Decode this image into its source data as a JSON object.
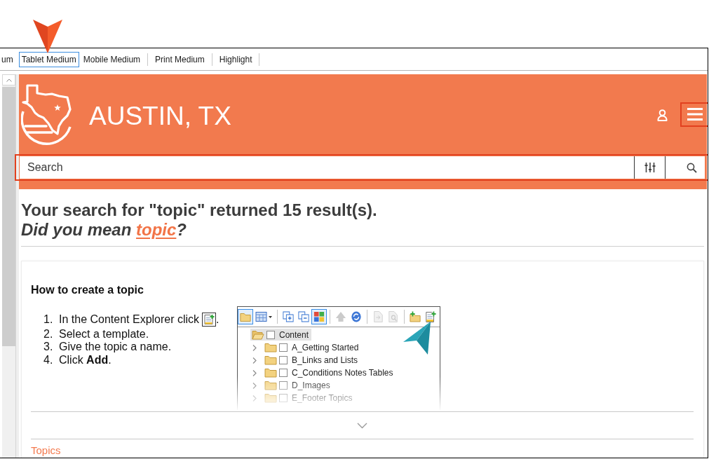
{
  "toolbar": {
    "tabs": [
      {
        "label": "um",
        "selected": false
      },
      {
        "label": "Tablet Medium",
        "selected": true
      },
      {
        "label": "Mobile Medium",
        "selected": false
      },
      {
        "label": "Print Medium",
        "selected": false
      },
      {
        "label": "Highlight",
        "selected": false
      }
    ]
  },
  "header": {
    "title": "AUSTIN, TX"
  },
  "search": {
    "placeholder": "Search"
  },
  "results": {
    "summary": "Your search for \"topic\" returned 15 result(s).",
    "suggestion": {
      "before": "Did you mean",
      "link": "topic",
      "after": "?"
    }
  },
  "result": {
    "title": "How to create a topic",
    "steps": [
      {
        "number": "1.",
        "kind": "icon",
        "text": "In the Content Explorer click",
        "after": "."
      },
      {
        "number": "2.",
        "kind": "text",
        "text": "Select a template."
      },
      {
        "number": "3.",
        "kind": "text",
        "text": "Give the topic a name."
      },
      {
        "number": "4.",
        "kind": "text",
        "text": "Click **Add**."
      }
    ],
    "screenshot": {
      "toolbar_groups": [
        [
          {
            "kind": "folder",
            "pressed": true,
            "disabled": false
          },
          {
            "kind": "table_dropdown",
            "pressed": false,
            "disabled": false
          }
        ],
        [
          {
            "kind": "copy_add",
            "pressed": false,
            "disabled": false
          },
          {
            "kind": "copy_remove",
            "pressed": false,
            "disabled": false
          },
          {
            "kind": "color_grid",
            "pressed": true,
            "disabled": false
          }
        ],
        [
          {
            "kind": "arrow",
            "pressed": false,
            "disabled": true
          },
          {
            "kind": "sync",
            "pressed": false,
            "disabled": false
          }
        ],
        [
          {
            "kind": "document",
            "pressed": false,
            "disabled": true
          },
          {
            "kind": "document_search",
            "pressed": false,
            "disabled": true
          }
        ],
        [
          {
            "kind": "folder_add",
            "pressed": false,
            "disabled": false
          },
          {
            "kind": "topic_add",
            "pressed": false,
            "disabled": false
          }
        ]
      ],
      "tree": {
        "label": "Content",
        "selected": true,
        "checked": false,
        "expanded": true,
        "children": [
          {
            "label": "A_Getting Started",
            "selected": false,
            "checked": false,
            "expanded": false
          },
          {
            "label": "B_Links and Lists",
            "selected": false,
            "checked": false,
            "expanded": false
          },
          {
            "label": "C_Conditions Notes Tables",
            "selected": false,
            "checked": false,
            "expanded": false
          },
          {
            "label": "D_Images",
            "selected": false,
            "checked": false,
            "expanded": false
          },
          {
            "label": "E_Footer Topics",
            "selected": false,
            "checked": false,
            "expanded": false
          }
        ]
      }
    },
    "expanded": false
  },
  "accordion": {
    "title": "Topics"
  }
}
